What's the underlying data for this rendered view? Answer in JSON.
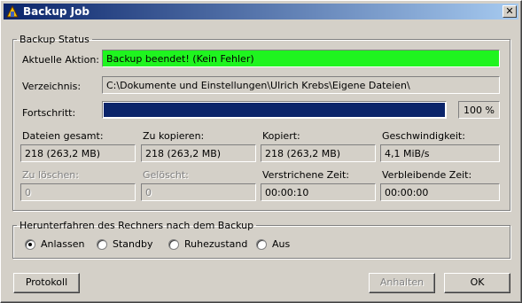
{
  "window": {
    "title": "Backup Job"
  },
  "status": {
    "legend": "Backup Status",
    "action_label": "Aktuelle Aktion:",
    "action_value": "Backup beendet! (Kein Fehler)",
    "dir_label": "Verzeichnis:",
    "dir_value": "C:\\Dokumente und Einstellungen\\Ulrich Krebs\\Eigene Dateien\\",
    "progress_label": "Fortschritt:",
    "progress_fraction": 1.0,
    "progress_text": "100 %",
    "files_total_label": "Dateien gesamt:",
    "files_total_value": "218 (263,2 MB)",
    "to_copy_label": "Zu kopieren:",
    "to_copy_value": "218 (263,2 MB)",
    "copied_label": "Kopiert:",
    "copied_value": "218 (263,2 MB)",
    "speed_label": "Geschwindigkeit:",
    "speed_value": "4,1 MiB/s",
    "to_delete_label": "Zu löschen:",
    "to_delete_value": "0",
    "deleted_label": "Gelöscht:",
    "deleted_value": "0",
    "elapsed_label": "Verstrichene Zeit:",
    "elapsed_value": "00:00:10",
    "remaining_label": "Verbleibende Zeit:",
    "remaining_value": "00:00:00"
  },
  "shutdown": {
    "legend": "Herunterfahren des Rechners nach dem Backup",
    "options": [
      "Anlassen",
      "Standby",
      "Ruhezustand",
      "Aus"
    ],
    "selected": "Anlassen"
  },
  "buttons": {
    "log": "Protokoll",
    "stop": "Anhalten",
    "ok": "OK"
  },
  "colors": {
    "action_bg": "#1ff41f",
    "progress_fill": "#0a246a",
    "title_bar": "#0a246a"
  }
}
